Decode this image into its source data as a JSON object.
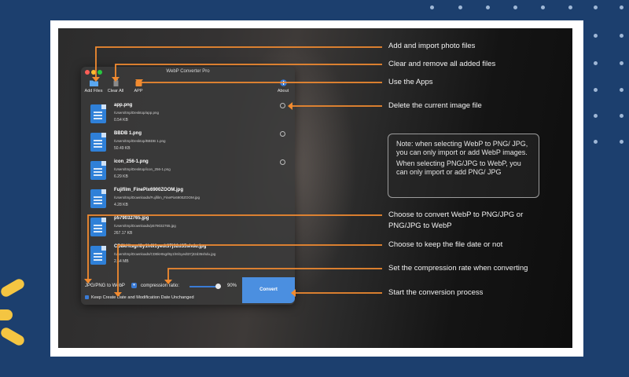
{
  "app": {
    "title": "WebP Converter Pro",
    "toolbar": [
      {
        "label": "Add Files",
        "icon": "folder-icon"
      },
      {
        "label": "Clear All",
        "icon": "trash-icon"
      },
      {
        "label": "APP",
        "icon": "app-icon"
      },
      {
        "label": "About",
        "icon": "info-icon"
      }
    ],
    "files": [
      {
        "name": "app.png",
        "path": "/Users/tmp/Desktop/app.png",
        "size": "0.54 KB"
      },
      {
        "name": "BBDB 1.png",
        "path": "/Users/tmp/Desktop/BBDB 1.png",
        "size": "50.49 KB"
      },
      {
        "name": "icon_256-1.png",
        "path": "/Users/tmp/Desktop/icon_256-1.png",
        "size": "6.29 KB"
      },
      {
        "name": "Fujifilm_FinePix6900ZOOM.jpg",
        "path": "/Users/tmp/Downloads/Fujifilm_FinePix6900ZOOM.jpg",
        "size": "4.28 KB"
      },
      {
        "name": "p579032765.jpg",
        "path": "/Users/tmp/Downloads/p579032765.jpg",
        "size": "267.17 KB"
      },
      {
        "name": "CD8kHtsgrl6y1h6l1yedt37j32d35shdu.jpg",
        "path": "/Users/tmp/Downloads/CD8kHtsgrl6y1h6l1yedt37j32d35shdu.jpg",
        "size": "2.54 MB"
      }
    ],
    "format_label": "JPG/PNG to WebP",
    "compression_label": "compression ratio:",
    "compression_value": "90%",
    "compression_fraction": 0.9,
    "keep_date_label": "Keep Create Date and Modification Date Unchanged",
    "convert_label": "Convert"
  },
  "callouts": [
    "Add and import photo files",
    "Clear and remove all added files",
    "Use the Apps",
    "Delete the current image file",
    "Choose to convert WebP to PNG/JPG or",
    "PNG/JPG to WebP",
    "Choose to keep the file date or not",
    "Set the compression rate when converting",
    "Start the conversion process"
  ],
  "note": {
    "line1": "Note: when selecting WebP to PNG/ JPG, you can only import or add WebP images.",
    "line2": "When selecting PNG/JPG to WebP, you can only import or add PNG/ JPG"
  },
  "colors": {
    "background": "#1c3f6e",
    "accent_orange": "#f28b30",
    "convert_blue": "#4b8fe0",
    "sun_yellow": "#f4c542"
  }
}
